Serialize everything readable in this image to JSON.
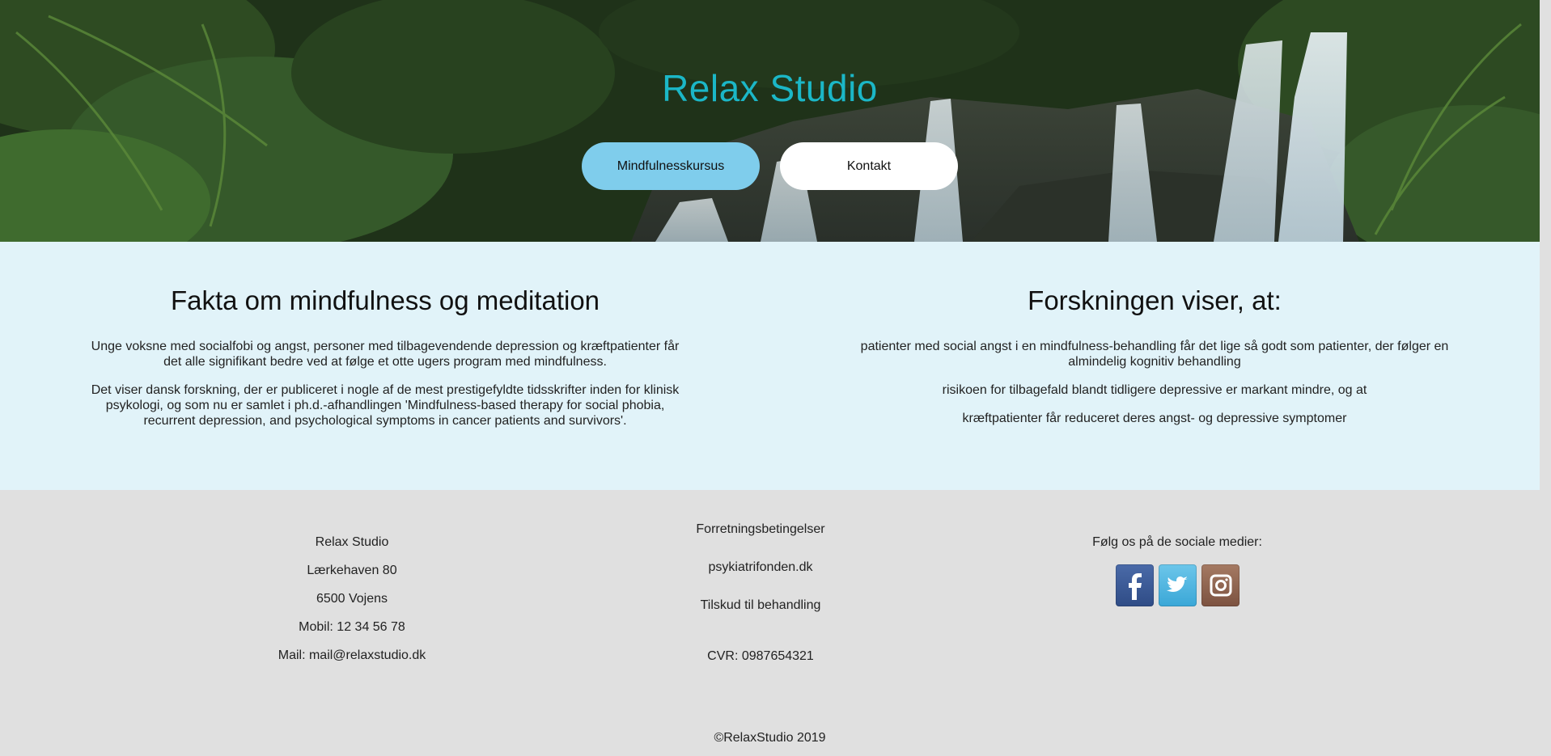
{
  "hero": {
    "title": "Relax Studio",
    "nav": {
      "course_label": "Mindfulnesskursus",
      "contact_label": "Kontakt"
    }
  },
  "facts": {
    "left": {
      "heading": "Fakta om mindfulness og meditation",
      "paragraphs": [
        "Unge voksne med socialfobi og angst, personer med tilbagevendende depression og kræftpatienter får det alle signifikant bedre ved at følge et otte ugers program med mindfulness.",
        "Det viser dansk forskning, der er publiceret i nogle af de mest prestigefyldte tidsskrifter inden for klinisk psykologi, og som nu er samlet i ph.d.-afhandlingen 'Mindfulness-based therapy for social phobia, recurrent depression, and psychological symptoms in cancer patients and survivors'."
      ]
    },
    "right": {
      "heading": "Forskningen viser, at:",
      "paragraphs": [
        "patienter med social angst i en mindfulness-behandling får det lige så godt som patienter, der følger en almindelig kognitiv behandling",
        "risikoen for tilbagefald blandt tidligere depressive er markant mindre, og at",
        "kræftpatienter får reduceret deres angst- og depressive symptomer"
      ]
    }
  },
  "footer": {
    "address": {
      "name": "Relax Studio",
      "street": "Lærkehaven 80",
      "city": "6500 Vojens",
      "phone": "Mobil: 12 34 56 78",
      "mail": "Mail: mail@relaxstudio.dk"
    },
    "links": {
      "terms": "Forretningsbetingelser",
      "psyk": "psykiatrifonden.dk",
      "grant": "Tilskud til behandling",
      "cvr": "CVR: 0987654321"
    },
    "social": {
      "heading": "Følg os på de sociale medier:",
      "icons": [
        "facebook-icon",
        "twitter-icon",
        "instagram-icon"
      ]
    },
    "copyright": "©RelaxStudio 2019"
  },
  "colors": {
    "title": "#1bb7c7",
    "primary_button": "#7fcdec",
    "facts_bg": "#e1f3f9",
    "footer_bg": "#e0e0e0"
  }
}
